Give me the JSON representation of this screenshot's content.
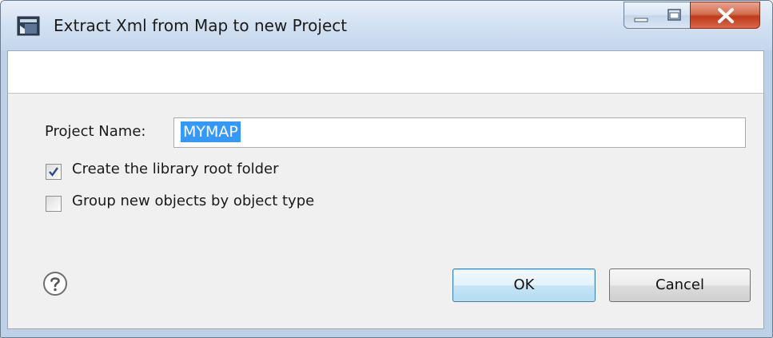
{
  "window": {
    "title": "Extract Xml from Map to new Project",
    "icons": {
      "app": "app-icon",
      "minimize": "minimize-icon",
      "maximize": "maximize-icon",
      "close": "close-icon"
    }
  },
  "form": {
    "project_name_label": "Project Name:",
    "project_name_value": "MYMAP",
    "create_root_folder": {
      "label": "Create the library root folder",
      "checked": true
    },
    "group_by_type": {
      "label": "Group new objects by object type",
      "checked": false
    }
  },
  "footer": {
    "help_icon": "help-icon",
    "ok_label": "OK",
    "cancel_label": "Cancel"
  },
  "colors": {
    "selection": "#3399ff",
    "close_button": "#c0391a",
    "dialog_bg": "#f0f0f0"
  }
}
